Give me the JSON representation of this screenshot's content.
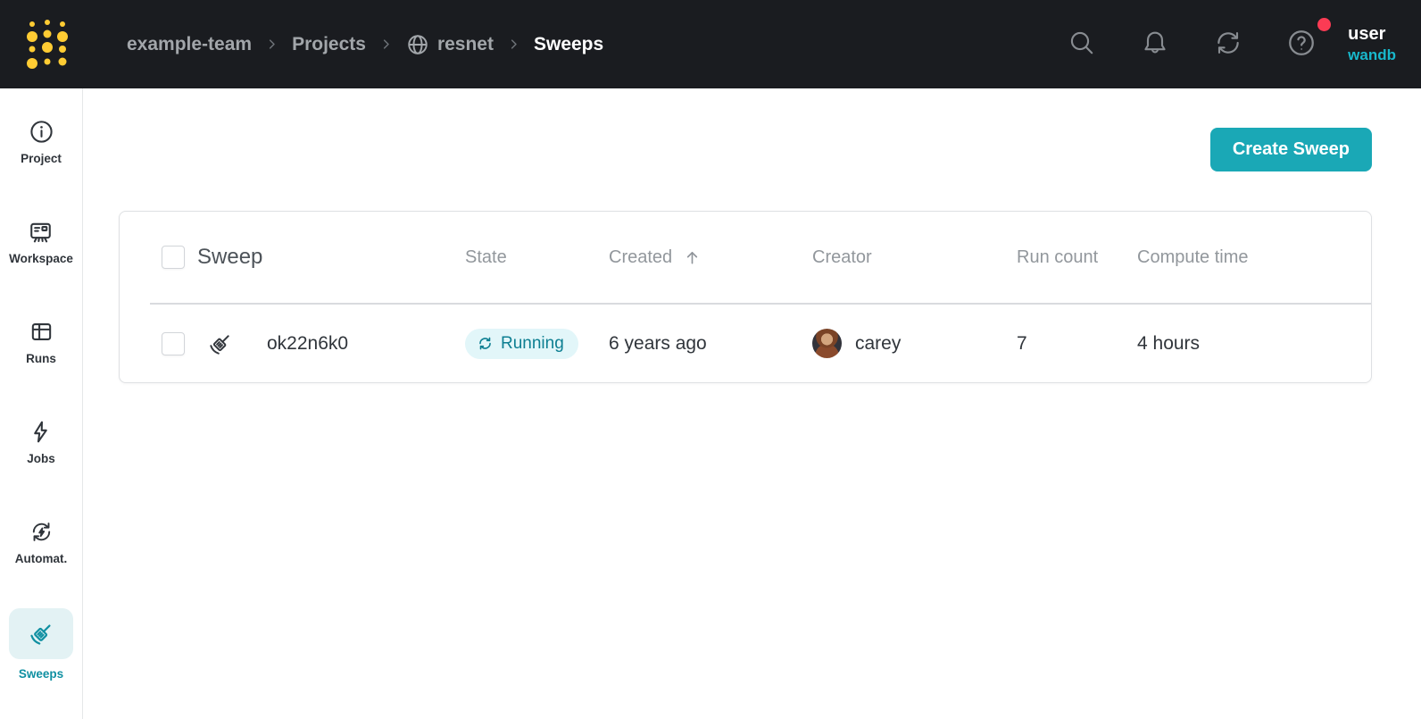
{
  "topbar": {
    "breadcrumb": {
      "team": "example-team",
      "projects": "Projects",
      "project": "resnet",
      "page": "Sweeps"
    },
    "user_name": "user",
    "org_name": "wandb",
    "has_notification_dot": true
  },
  "sidebar": {
    "items": [
      {
        "label": "Project",
        "icon": "info-icon",
        "active": false
      },
      {
        "label": "Workspace",
        "icon": "workspace-board-icon",
        "active": false
      },
      {
        "label": "Runs",
        "icon": "runs-table-icon",
        "active": false
      },
      {
        "label": "Jobs",
        "icon": "lightning-icon",
        "active": false
      },
      {
        "label": "Automat.",
        "icon": "automation-loop-icon",
        "active": false
      },
      {
        "label": "Sweeps",
        "icon": "broom-icon",
        "active": true
      }
    ]
  },
  "main": {
    "create_button": "Create Sweep",
    "table": {
      "columns": [
        "Sweep",
        "State",
        "Created",
        "Creator",
        "Run count",
        "Compute time"
      ],
      "sorted_column": "Created",
      "sort_direction": "ascending",
      "rows": [
        {
          "name": "ok22n6k0",
          "state": "Running",
          "created": "6 years ago",
          "creator": "carey",
          "run_count": "7",
          "compute_time": "4 hours"
        }
      ]
    }
  },
  "icons": {
    "topbar": [
      "wandb-logo",
      "chevron-right-icon",
      "globe-icon",
      "search-icon",
      "bell-icon",
      "refresh-icon",
      "help-icon",
      "notification-dot"
    ],
    "sidebar": [
      "info-icon",
      "workspace-board-icon",
      "runs-table-icon",
      "lightning-icon",
      "automation-loop-icon",
      "broom-icon"
    ],
    "table": [
      "checkbox",
      "broom-icon",
      "running-loop-icon",
      "sort-ascending-icon",
      "avatar"
    ]
  },
  "colors": {
    "topbar_bg": "#1a1c20",
    "accent_teal": "#1aa8b6",
    "topbar_link_teal": "#18b8cc",
    "badge_bg": "#e2f6f9",
    "badge_text": "#0d7f92",
    "active_item_bg": "#e3f2f4",
    "active_item_text": "#1090a2",
    "logo_gold": "#ffcc33",
    "notification_red": "#fb3b54"
  }
}
